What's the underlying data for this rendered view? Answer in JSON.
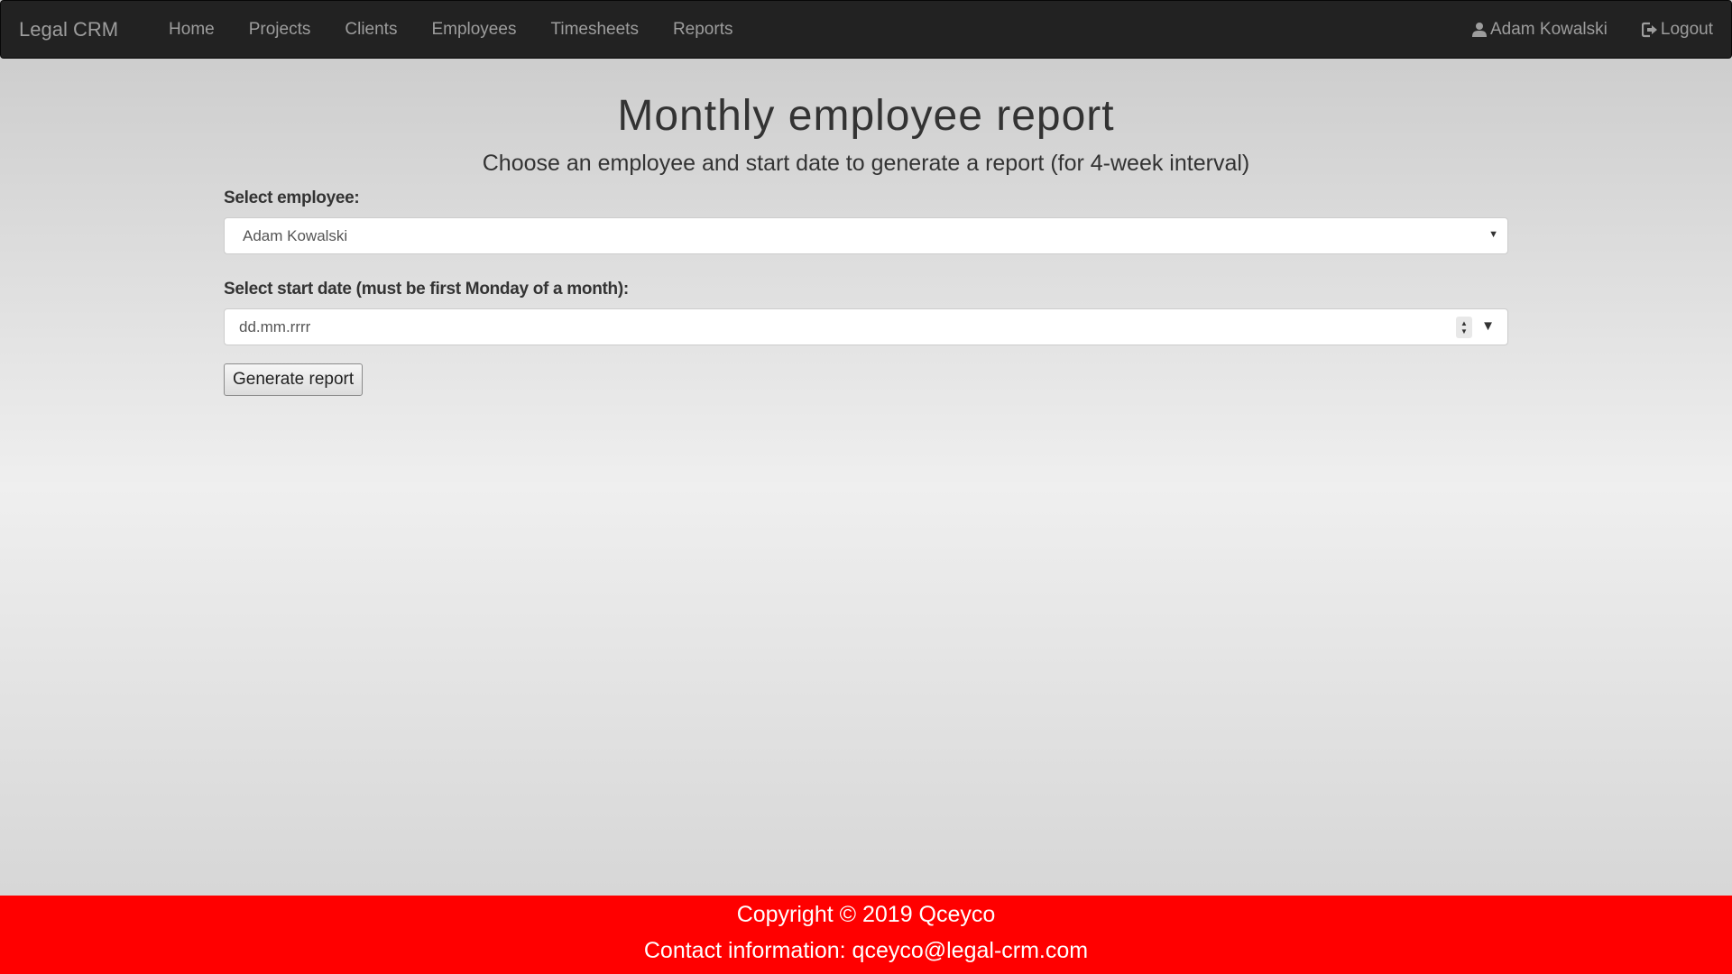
{
  "navbar": {
    "brand": "Legal CRM",
    "links": [
      "Home",
      "Projects",
      "Clients",
      "Employees",
      "Timesheets",
      "Reports"
    ],
    "user": {
      "name": "Adam Kowalski",
      "icon": "user-icon"
    },
    "logout": {
      "label": "Logout",
      "icon": "logout-icon"
    }
  },
  "main": {
    "title": "Monthly employee report",
    "subtitle": "Choose an employee and start date to generate a report (for 4-week interval)",
    "employee_label": "Select employee:",
    "employee_value": "Adam Kowalski",
    "date_label": "Select start date (must be first Monday of a month):",
    "date_placeholder": "dd.mm.rrrr",
    "submit_label": "Generate report"
  },
  "footer": {
    "copyright": "Copyright © 2019 Qceyco",
    "contact": "Contact information: qceyco@legal-crm.com"
  }
}
